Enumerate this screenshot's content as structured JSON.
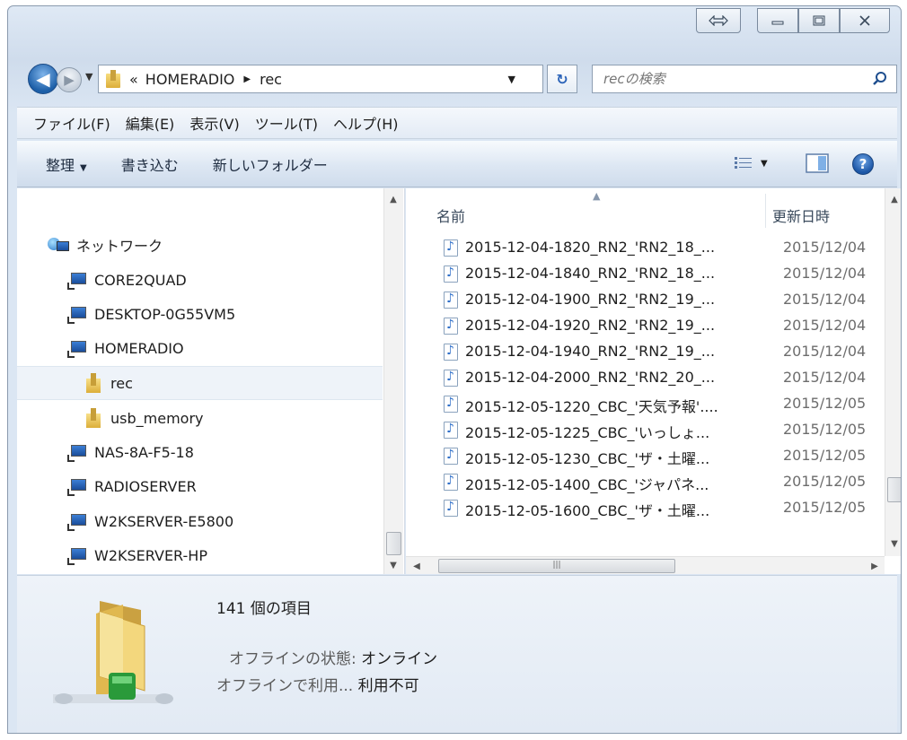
{
  "window": {
    "caption_buttons": [
      "snap-arrows-icon",
      "minimize-icon",
      "maximize-icon",
      "close-icon"
    ]
  },
  "nav": {
    "breadcrumb": [
      "HOMERADIO",
      "rec"
    ],
    "overflow_chevron": "«",
    "search_placeholder": "recの検索"
  },
  "menu": [
    "ファイル(F)",
    "編集(E)",
    "表示(V)",
    "ツール(T)",
    "ヘルプ(H)"
  ],
  "commands": {
    "organize": "整理",
    "burn": "書き込む",
    "new_folder": "新しいフォルダー"
  },
  "tree": {
    "network": "ネットワーク",
    "computers": [
      {
        "label": "CORE2QUAD",
        "kind": "pc"
      },
      {
        "label": "DESKTOP-0G55VM5",
        "kind": "pc"
      },
      {
        "label": "HOMERADIO",
        "kind": "pc"
      },
      {
        "label": "rec",
        "kind": "folder",
        "selected": true
      },
      {
        "label": "usb_memory",
        "kind": "folder"
      },
      {
        "label": "NAS-8A-F5-18",
        "kind": "pc"
      },
      {
        "label": "RADIOSERVER",
        "kind": "pc"
      },
      {
        "label": "W2KSERVER-E5800",
        "kind": "pc"
      },
      {
        "label": "W2KSERVER-HP",
        "kind": "pc"
      }
    ]
  },
  "files": {
    "col_name": "名前",
    "col_date": "更新日時",
    "rows": [
      {
        "name": "2015-12-04-1820_RN2_'RN2_18_...",
        "date": "2015/12/04"
      },
      {
        "name": "2015-12-04-1840_RN2_'RN2_18_...",
        "date": "2015/12/04"
      },
      {
        "name": "2015-12-04-1900_RN2_'RN2_19_...",
        "date": "2015/12/04"
      },
      {
        "name": "2015-12-04-1920_RN2_'RN2_19_...",
        "date": "2015/12/04"
      },
      {
        "name": "2015-12-04-1940_RN2_'RN2_19_...",
        "date": "2015/12/04"
      },
      {
        "name": "2015-12-04-2000_RN2_'RN2_20_...",
        "date": "2015/12/04"
      },
      {
        "name": "2015-12-05-1220_CBC_'天気予報'....",
        "date": "2015/12/05"
      },
      {
        "name": "2015-12-05-1225_CBC_'いっしょ...",
        "date": "2015/12/05"
      },
      {
        "name": "2015-12-05-1230_CBC_'ザ・土曜...",
        "date": "2015/12/05"
      },
      {
        "name": "2015-12-05-1400_CBC_'ジャパネ...",
        "date": "2015/12/05"
      },
      {
        "name": "2015-12-05-1600_CBC_'ザ・土曜...",
        "date": "2015/12/05"
      }
    ]
  },
  "details": {
    "item_count": "141 個の項目",
    "offline_status_label": "オフラインの状態:",
    "offline_status_value": "オンライン",
    "offline_avail_label": "オフラインで利用...",
    "offline_avail_value": "利用不可"
  },
  "colors": {
    "accent": "#1d5fa8",
    "folder": "#e8c25a"
  }
}
